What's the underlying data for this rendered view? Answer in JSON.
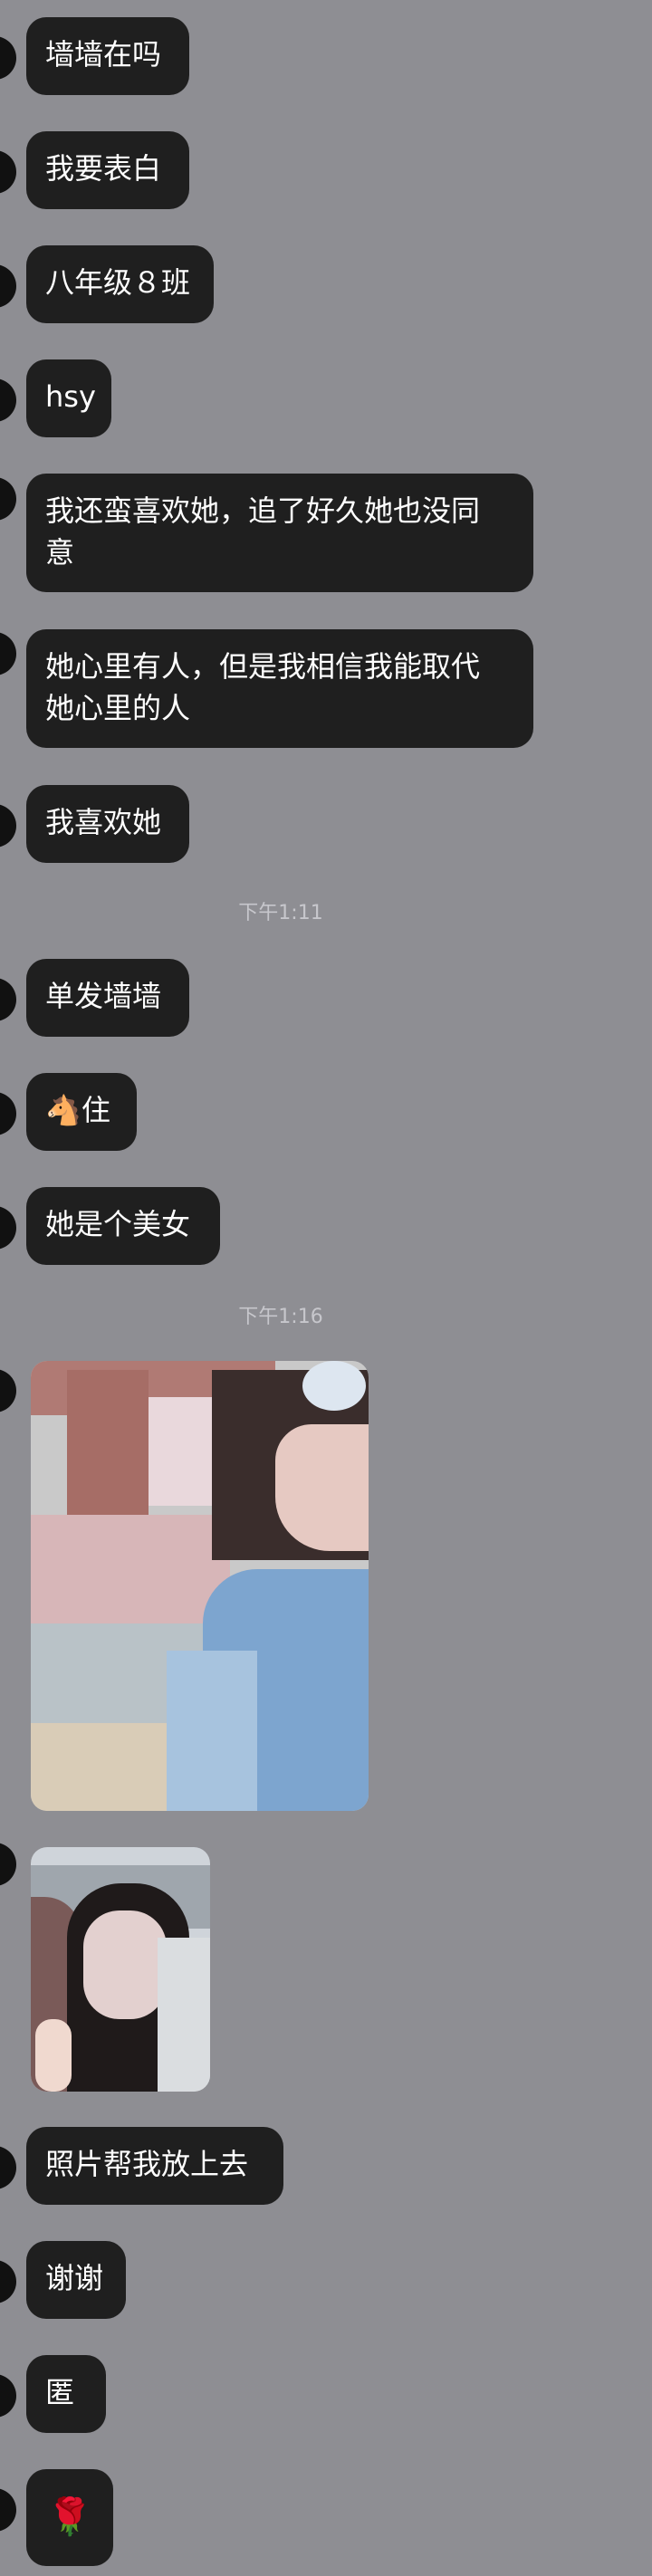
{
  "messages": [
    {
      "text": "墙墙在吗"
    },
    {
      "text": "我要表白"
    },
    {
      "text": "八年级８班"
    },
    {
      "text": "hsy"
    },
    {
      "text": "我还蛮喜欢她，追了好久她也没同\n意"
    },
    {
      "text": "她心里有人，但是我相信我能取代\n她心里的人"
    },
    {
      "text": "我喜欢她"
    },
    {
      "text": "单发墙墙"
    },
    {
      "text": "🐴住"
    },
    {
      "text": "她是个美女"
    },
    {
      "text": "照片帮我放上去"
    },
    {
      "text": "谢谢"
    },
    {
      "text": "匿"
    },
    {
      "text": "🌹"
    }
  ],
  "timestamps": [
    "下午1:11",
    "下午1:16"
  ],
  "photos": [
    {
      "name": "photo-1",
      "alt": "selfie photo 1"
    },
    {
      "name": "photo-2",
      "alt": "selfie photo 2"
    }
  ],
  "colors": {
    "background": "#8e8e93",
    "bubble": "#1f1f1f",
    "text": "#ffffff",
    "timestamp": "#c7c7cc"
  }
}
